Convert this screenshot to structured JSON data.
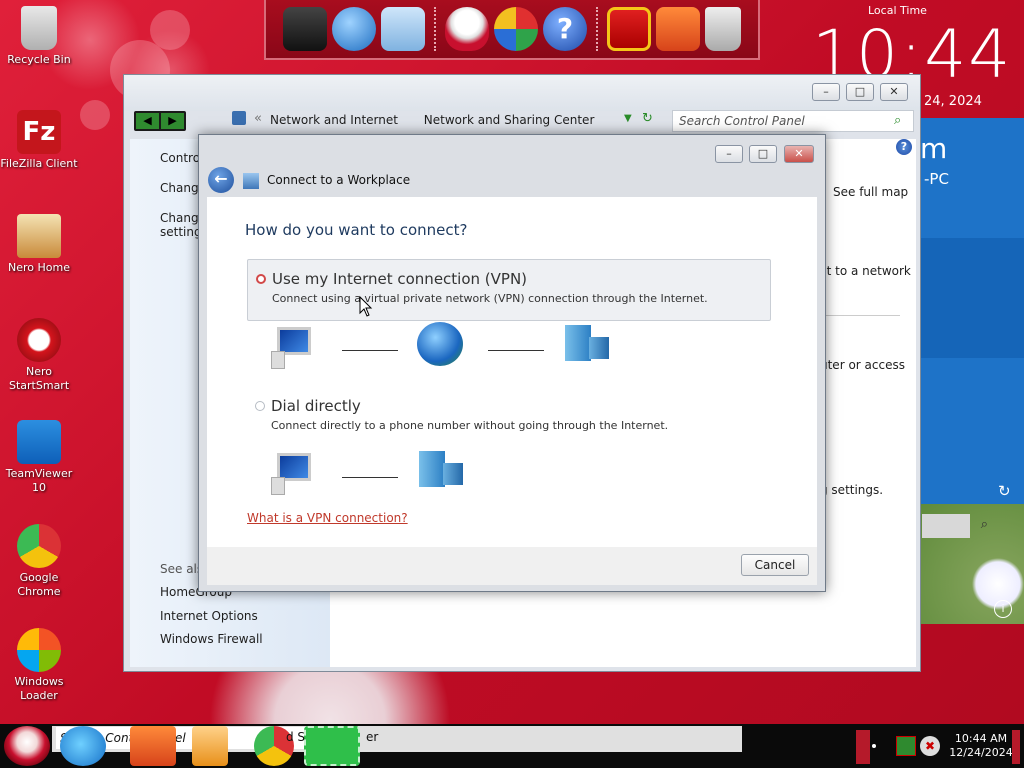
{
  "desktop": {
    "icons": [
      {
        "label": "Recycle Bin",
        "icon": "recycle-bin-icon"
      },
      {
        "label": "FileZilla Client",
        "icon": "filezilla-icon"
      },
      {
        "label": "Nero Home",
        "icon": "nero-home-icon"
      },
      {
        "label": "Nero StartSmart",
        "icon": "nero-startsmart-icon"
      },
      {
        "label": "TeamViewer 10",
        "icon": "teamviewer-icon"
      },
      {
        "label": "Google Chrome",
        "icon": "chrome-icon"
      },
      {
        "label": "Windows Loader",
        "icon": "windows-loader-icon"
      }
    ]
  },
  "clock_widget": {
    "label": "Local Time",
    "time": "10:44",
    "date": "24, 2024"
  },
  "side_panel": {
    "heading_fragment": "m",
    "pc_fragment": "-PC"
  },
  "control_panel": {
    "breadcrumb": [
      "Network and Internet",
      "Network and Sharing Center"
    ],
    "search_placeholder": "Search Control Panel",
    "left_links": [
      "Control",
      "Change",
      "Change",
      "settings"
    ],
    "see_also": "See also",
    "bottom_links": [
      "HomeGroup",
      "Internet Options",
      "Windows Firewall"
    ],
    "see_full_map": "See full map",
    "right_fragments": [
      "ct to a network",
      "uter or access",
      "g settings."
    ]
  },
  "dialog": {
    "title": "Connect to a Workplace",
    "question": "How do you want to connect?",
    "options": [
      {
        "heading": "Use my Internet connection (VPN)",
        "description": "Connect using a virtual private network (VPN) connection through the Internet.",
        "selected": true
      },
      {
        "heading": "Dial directly",
        "description": "Connect directly to a phone number without going through the Internet.",
        "selected": false
      }
    ],
    "help_link": "What is a VPN connection?",
    "cancel_label": "Cancel"
  },
  "taskbar": {
    "search_text": "Search Control Panel",
    "window_fragment": "d S",
    "window_fragment2": "er",
    "time": "10:44 AM",
    "date": "12/24/2024"
  }
}
